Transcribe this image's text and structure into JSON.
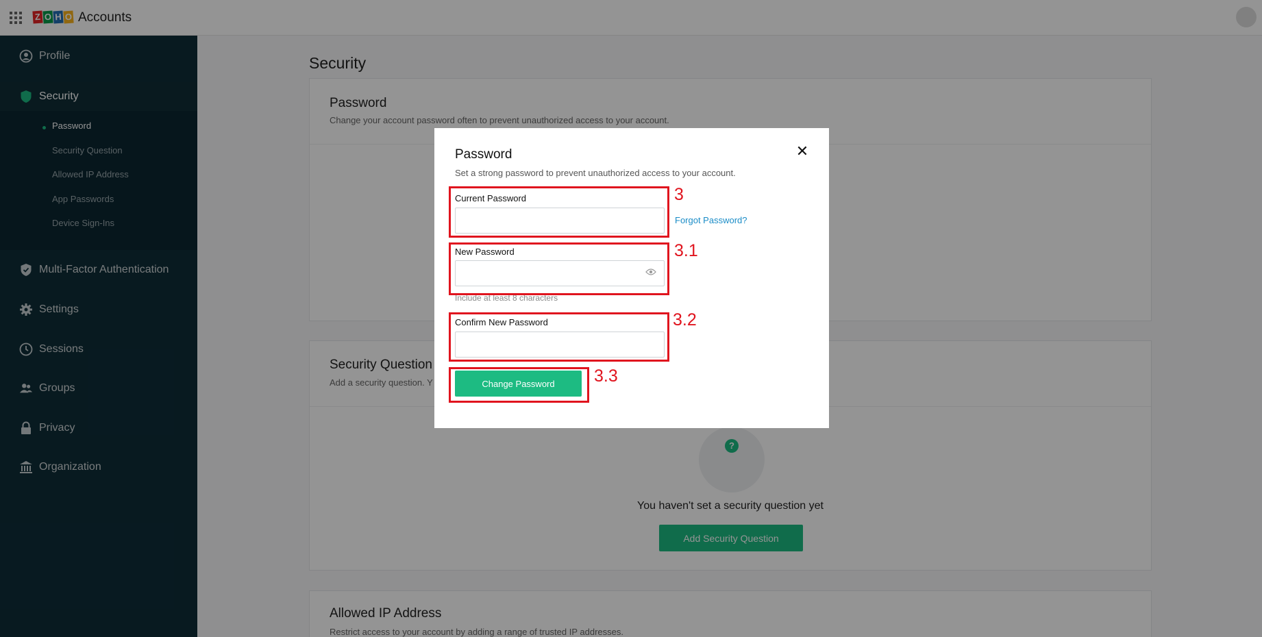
{
  "topbar": {
    "logo_letters": [
      "Z",
      "O",
      "H",
      "O"
    ],
    "logo_colors": [
      "#e42527",
      "#089949",
      "#226db4",
      "#f9b21d"
    ],
    "brand": "Accounts"
  },
  "sidebar": {
    "items": [
      {
        "label": "Profile",
        "icon": "user-circle-icon"
      },
      {
        "label": "Security",
        "icon": "shield-icon"
      },
      {
        "label": "Multi-Factor Authentication",
        "icon": "shield-check-icon"
      },
      {
        "label": "Settings",
        "icon": "gear-icon"
      },
      {
        "label": "Sessions",
        "icon": "clock-icon"
      },
      {
        "label": "Groups",
        "icon": "group-icon"
      },
      {
        "label": "Privacy",
        "icon": "lock-icon"
      },
      {
        "label": "Organization",
        "icon": "building-icon"
      }
    ],
    "security_sub": [
      "Password",
      "Security Question",
      "Allowed IP Address",
      "App Passwords",
      "Device Sign-Ins"
    ]
  },
  "main": {
    "page_title": "Security",
    "password_card": {
      "title": "Password",
      "desc": "Change your account password often to prevent unauthorized access to your account."
    },
    "security_question_card": {
      "title": "Security Question",
      "desc": "Add a security question. Y",
      "empty_text": "You haven't set a security question yet",
      "button": "Add Security Question"
    },
    "allowed_ip_card": {
      "title": "Allowed IP Address",
      "desc": "Restrict access to your account by adding a range of trusted IP addresses."
    }
  },
  "modal": {
    "title": "Password",
    "desc": "Set a strong password to prevent unauthorized access to your account.",
    "current_label": "Current Password",
    "current_value": "",
    "forgot": "Forgot Password?",
    "new_label": "New Password",
    "new_value": "",
    "hint": "Include at least 8 characters",
    "confirm_label": "Confirm New Password",
    "confirm_value": "",
    "change_button": "Change Password",
    "close": "✕"
  },
  "annotations": [
    "3",
    "3.1",
    "3.2",
    "3.3"
  ],
  "colors": {
    "accent": "#1dbb82",
    "sidebar_bg": "#0e2d38",
    "annotation": "#e0141e",
    "link": "#1a8cc7"
  }
}
